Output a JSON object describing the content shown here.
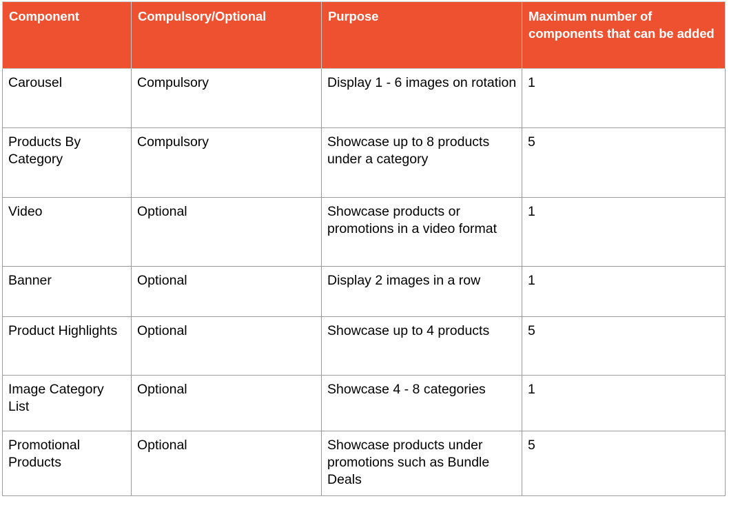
{
  "table": {
    "accent_color": "#ee5130",
    "border_color": "#9c9c9c",
    "header_text_color": "#ffffff",
    "columns": [
      {
        "key": "component",
        "label": "Component"
      },
      {
        "key": "compulsory_optional",
        "label": "Compulsory/Optional"
      },
      {
        "key": "purpose",
        "label": "Purpose"
      },
      {
        "key": "maximum_number",
        "label": "Maximum number of components that can be added"
      }
    ],
    "rows": [
      {
        "component": "Carousel",
        "compulsory_optional": "Compulsory",
        "purpose": "Display 1 - 6 images on rotation",
        "maximum_number": "1"
      },
      {
        "component": "Products By Category",
        "compulsory_optional": "Compulsory",
        "purpose": "Showcase up to 8 products under a category",
        "maximum_number": "5"
      },
      {
        "component": "Video",
        "compulsory_optional": "Optional",
        "purpose": "Showcase products or promotions in a video format",
        "maximum_number": "1"
      },
      {
        "component": "Banner",
        "compulsory_optional": "Optional",
        "purpose": "Display 2 images in a row",
        "maximum_number": "1"
      },
      {
        "component": "Product Highlights",
        "compulsory_optional": "Optional",
        "purpose": "Showcase up to 4 products",
        "maximum_number": "5"
      },
      {
        "component": "Image Category List",
        "compulsory_optional": "Optional",
        "purpose": "Showcase 4 - 8 categories",
        "maximum_number": "1"
      },
      {
        "component": "Promotional Products",
        "compulsory_optional": "Optional",
        "purpose": "Showcase products under promotions such as Bundle Deals",
        "maximum_number": "5"
      }
    ]
  }
}
